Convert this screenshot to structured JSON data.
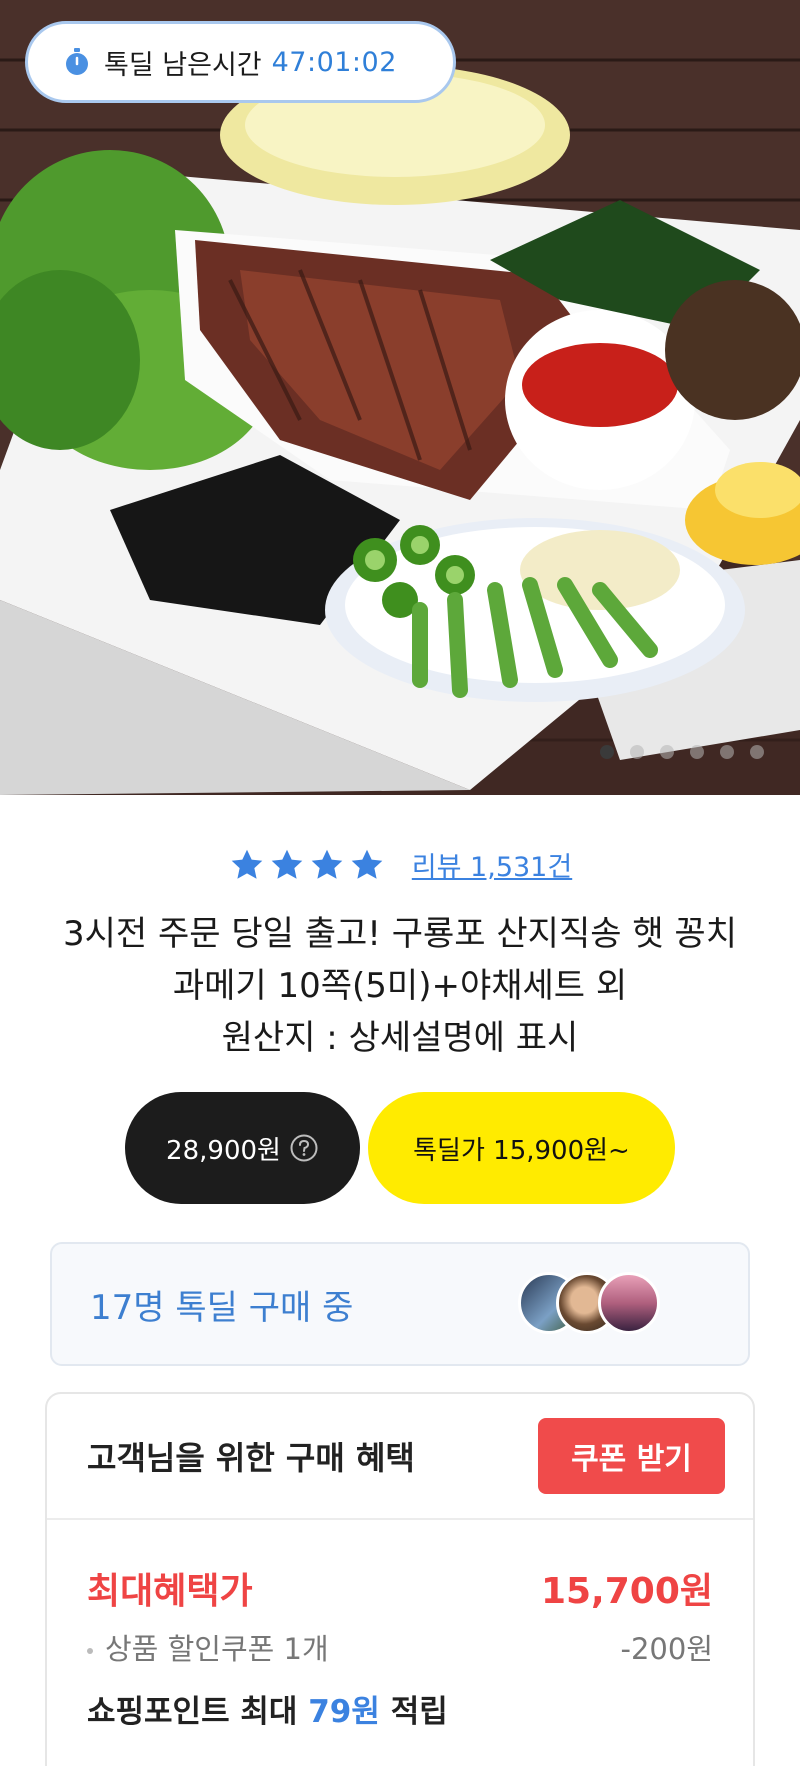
{
  "timer": {
    "label": "톡딜 남은시간",
    "value": "47:01:02",
    "icon": "stopwatch-icon"
  },
  "carousel": {
    "total": 6,
    "active": 0
  },
  "review": {
    "stars": 4,
    "label": "리뷰 1,531건"
  },
  "product": {
    "title_lines": [
      "3시전 주문 당일 출고! 구룡포 산지직송 햇 꽁치",
      "과메기 10쪽(5미)+야채세트 외",
      "원산지 : 상세설명에 표시"
    ]
  },
  "prices": {
    "original": "28,900원",
    "deal": "톡딜가  15,900원~"
  },
  "buyers": {
    "text": "17명 톡딜 구매 중"
  },
  "benefit": {
    "title": "고객님을 위한 구매 혜택",
    "coupon_button": "쿠폰 받기",
    "max_label": "최대혜택가",
    "max_value": "15,700원",
    "coupon_item": "상품 할인쿠폰 1개",
    "coupon_discount": "-200원",
    "point_prefix": "쇼핑포인트 최대",
    "point_amount": "79원",
    "point_suffix": "적립"
  },
  "colors": {
    "accent_blue": "#3b82e0",
    "deal_yellow": "#ffeb00",
    "red": "#ef4444"
  }
}
